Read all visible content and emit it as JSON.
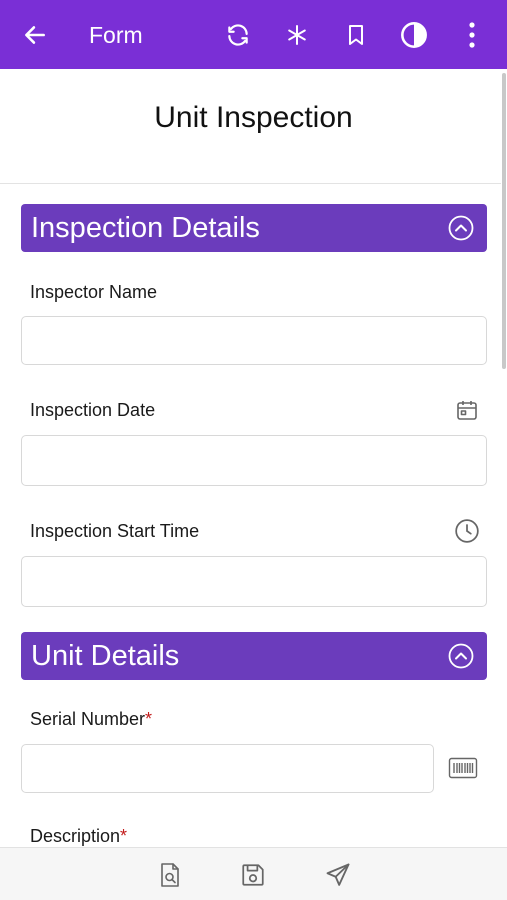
{
  "appbar": {
    "title": "Form",
    "icons": [
      "back-arrow-icon",
      "refresh-icon",
      "asterisk-icon",
      "bookmark-icon",
      "contrast-icon",
      "more-vert-icon"
    ]
  },
  "form": {
    "title": "Unit Inspection"
  },
  "sections": [
    {
      "label": "Inspection Details",
      "fields": [
        {
          "label": "Inspector Name",
          "value": "",
          "required": false
        },
        {
          "label": "Inspection Date",
          "value": "",
          "required": false,
          "icon": "calendar-icon"
        },
        {
          "label": "Inspection Start Time",
          "value": "",
          "required": false,
          "icon": "clock-icon"
        }
      ]
    },
    {
      "label": "Unit Details",
      "fields": [
        {
          "label": "Serial Number",
          "value": "",
          "required": true,
          "icon": "barcode-icon"
        },
        {
          "label": "Description",
          "value": "",
          "required": true
        }
      ]
    }
  ],
  "required_marker": "*",
  "bottombar": {
    "icons": [
      "preview-document-icon",
      "save-icon",
      "send-icon"
    ]
  },
  "colors": {
    "appbar": "#7a2fd6",
    "section_header": "#6b3cbc",
    "required": "#c21b1b"
  }
}
